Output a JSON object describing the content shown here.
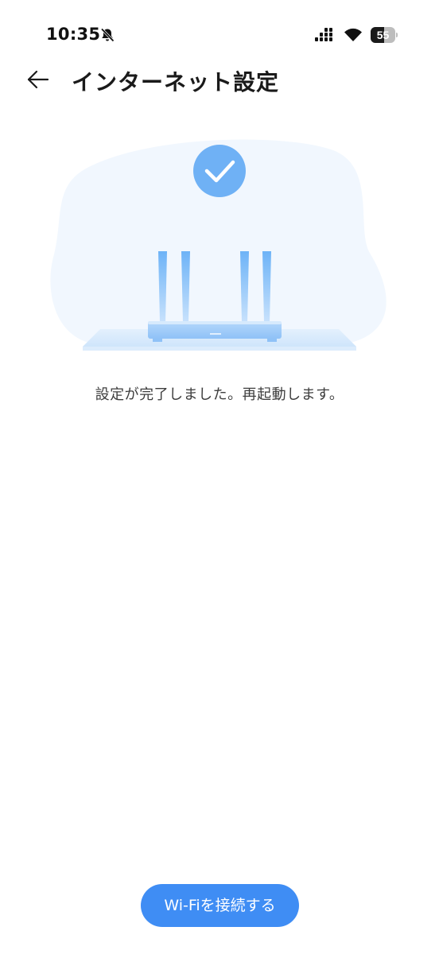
{
  "status_bar": {
    "time": "10:35",
    "battery_level": "55",
    "battery_fraction": 0.55,
    "icons": [
      "bell-off-icon",
      "signal-icon",
      "wifi-icon",
      "battery-icon"
    ]
  },
  "header": {
    "back_icon": "arrow-left-icon",
    "title": "インターネット設定"
  },
  "illustration": {
    "icons": [
      "checkmark-icon",
      "router-icon"
    ],
    "accent_color": "#6fb1f5",
    "background_color": "#f1f7fe"
  },
  "message": "設定が完了しました。再起動します。",
  "connect_button": {
    "label": "Wi-Fiを接続する",
    "color": "#3f8df4"
  }
}
